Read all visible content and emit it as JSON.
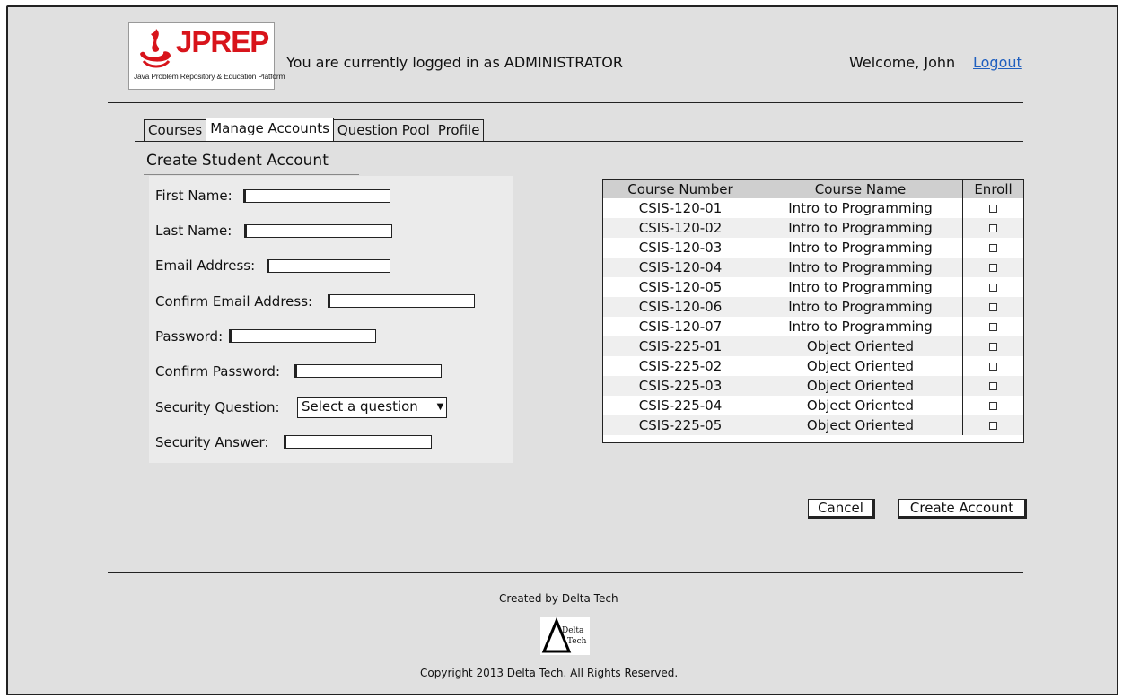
{
  "header": {
    "logo_text": "JPREP",
    "logo_subtitle": "Java Problem Repository & Education Platform",
    "login_status": "You are currently logged in as ADMINISTRATOR",
    "welcome": "Welcome, John",
    "logout": "Logout",
    "logo_color": "#d8141b",
    "link_color": "#1f5fbf"
  },
  "tabs": [
    "Courses",
    "Manage Accounts",
    "Question Pool",
    "Profile"
  ],
  "active_tab": "Manage Accounts",
  "section_title": "Create Student Account",
  "form": {
    "first_name": "First Name:",
    "last_name": "Last Name:",
    "email": "Email Address:",
    "confirm_email": "Confirm Email Address:",
    "password": "Password:",
    "confirm_password": "Confirm Password:",
    "security_question": "Security Question:",
    "security_question_value": "Select a question",
    "security_answer": "Security Answer:"
  },
  "course_table": {
    "headers": [
      "Course Number",
      "Course Name",
      "Enroll"
    ],
    "rows": [
      [
        "CSIS-120-01",
        "Intro to Programming"
      ],
      [
        "CSIS-120-02",
        "Intro to Programming"
      ],
      [
        "CSIS-120-03",
        "Intro to Programming"
      ],
      [
        "CSIS-120-04",
        "Intro to Programming"
      ],
      [
        "CSIS-120-05",
        "Intro to Programming"
      ],
      [
        "CSIS-120-06",
        "Intro to Programming"
      ],
      [
        "CSIS-120-07",
        "Intro to Programming"
      ],
      [
        "CSIS-225-01",
        "Object Oriented"
      ],
      [
        "CSIS-225-02",
        "Object Oriented"
      ],
      [
        "CSIS-225-03",
        "Object Oriented"
      ],
      [
        "CSIS-225-04",
        "Object Oriented"
      ],
      [
        "CSIS-225-05",
        "Object Oriented"
      ]
    ]
  },
  "buttons": {
    "cancel": "Cancel",
    "create_account": "Create Account"
  },
  "footer": {
    "credit": "Created by Delta Tech",
    "logo_line1": "Delta",
    "logo_line2": "Tech",
    "copyright": "Copyright 2013 Delta Tech. All Rights Reserved."
  }
}
